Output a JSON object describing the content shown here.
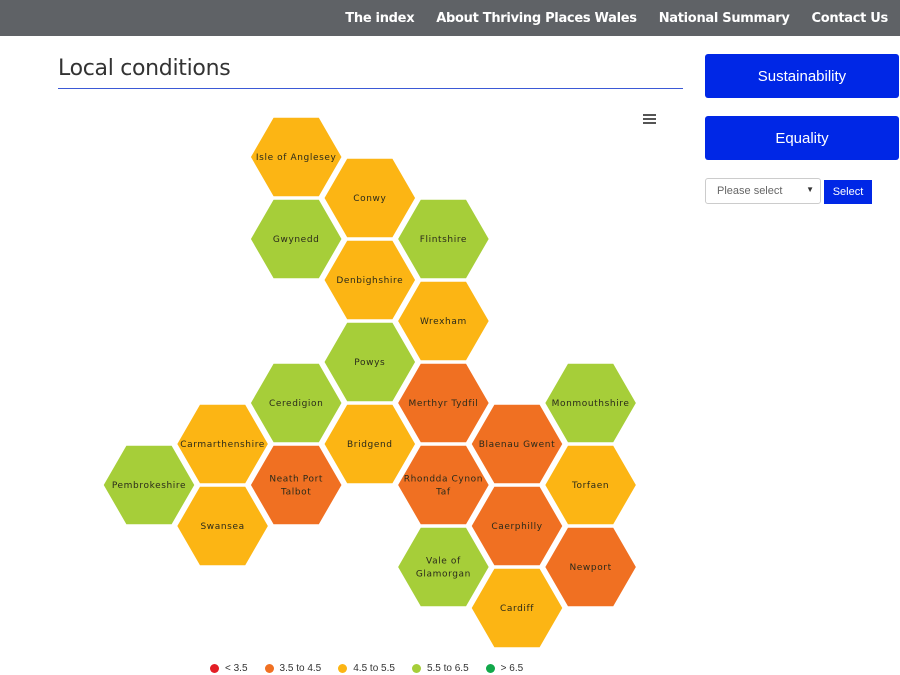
{
  "nav": {
    "items": [
      "The index",
      "About Thriving Places Wales",
      "National Summary",
      "Contact Us"
    ]
  },
  "page": {
    "title": "Local conditions"
  },
  "sidebar": {
    "buttons": [
      "Sustainability",
      "Equality"
    ],
    "select_placeholder": "Please select",
    "select_button": "Select"
  },
  "chart_data": {
    "type": "heatmap",
    "subtype": "hex-tile-map",
    "title": "Local conditions",
    "legend_placement": "bottom",
    "bands": [
      {
        "label": "< 3.5",
        "color": "#e31e25"
      },
      {
        "label": "3.5 to 4.5",
        "color": "#f07022"
      },
      {
        "label": "4.5 to 5.5",
        "color": "#fcb514"
      },
      {
        "label": "5.5 to 6.5",
        "color": "#a6ce39"
      },
      {
        "label": "> 6.5",
        "color": "#12a84a"
      }
    ],
    "tiles": [
      {
        "name": "Isle of Anglesey",
        "col": 2,
        "row": 0,
        "band": "4.5 to 5.5"
      },
      {
        "name": "Conwy",
        "col": 3,
        "row": 1,
        "band": "4.5 to 5.5"
      },
      {
        "name": "Gwynedd",
        "col": 2,
        "row": 2,
        "band": "5.5 to 6.5"
      },
      {
        "name": "Flintshire",
        "col": 4,
        "row": 2,
        "band": "5.5 to 6.5"
      },
      {
        "name": "Denbighshire",
        "col": 3,
        "row": 3,
        "band": "4.5 to 5.5"
      },
      {
        "name": "Wrexham",
        "col": 4,
        "row": 4,
        "band": "4.5 to 5.5"
      },
      {
        "name": "Powys",
        "col": 3,
        "row": 5,
        "band": "5.5 to 6.5"
      },
      {
        "name": "Ceredigion",
        "col": 2,
        "row": 6,
        "band": "5.5 to 6.5"
      },
      {
        "name": "Merthyr Tydfil",
        "col": 4,
        "row": 6,
        "band": "3.5 to 4.5"
      },
      {
        "name": "Monmouthshire",
        "col": 6,
        "row": 6,
        "band": "5.5 to 6.5"
      },
      {
        "name": "Carmarthenshire",
        "col": 1,
        "row": 7,
        "band": "4.5 to 5.5"
      },
      {
        "name": "Bridgend",
        "col": 3,
        "row": 7,
        "band": "4.5 to 5.5"
      },
      {
        "name": "Blaenau Gwent",
        "col": 5,
        "row": 7,
        "band": "3.5 to 4.5"
      },
      {
        "name": "Pembrokeshire",
        "col": 0,
        "row": 8,
        "band": "5.5 to 6.5"
      },
      {
        "name": "Neath Port Talbot",
        "col": 2,
        "row": 8,
        "band": "3.5 to 4.5",
        "lines": [
          "Neath Port",
          "Talbot"
        ]
      },
      {
        "name": "Rhondda Cynon Taf",
        "col": 4,
        "row": 8,
        "band": "3.5 to 4.5",
        "lines": [
          "Rhondda Cynon",
          "Taf"
        ]
      },
      {
        "name": "Torfaen",
        "col": 6,
        "row": 8,
        "band": "4.5 to 5.5"
      },
      {
        "name": "Swansea",
        "col": 1,
        "row": 9,
        "band": "4.5 to 5.5"
      },
      {
        "name": "Caerphilly",
        "col": 5,
        "row": 9,
        "band": "3.5 to 4.5"
      },
      {
        "name": "Vale of Glamorgan",
        "col": 4,
        "row": 10,
        "band": "5.5 to 6.5",
        "lines": [
          "Vale of",
          "Glamorgan"
        ]
      },
      {
        "name": "Newport",
        "col": 6,
        "row": 10,
        "band": "3.5 to 4.5"
      },
      {
        "name": "Cardiff",
        "col": 5,
        "row": 11,
        "band": "4.5 to 5.5"
      }
    ]
  }
}
